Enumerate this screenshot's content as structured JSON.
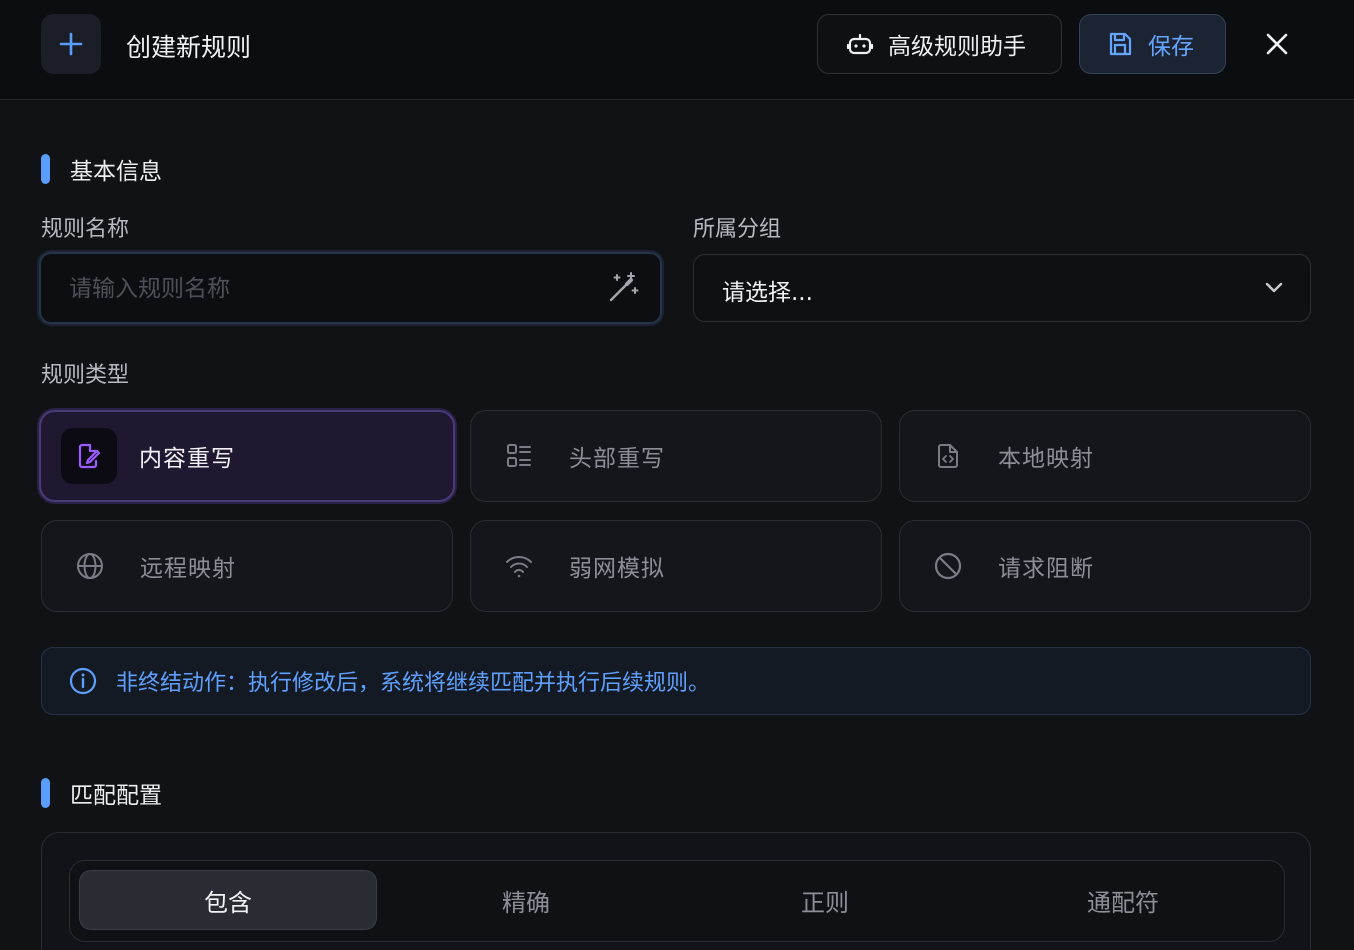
{
  "header": {
    "title": "创建新规则",
    "assistant_label": "高级规则助手",
    "save_label": "保存"
  },
  "basic": {
    "section_title": "基本信息",
    "name_label": "规则名称",
    "name_placeholder": "请输入规则名称",
    "name_value": "",
    "group_label": "所属分组",
    "group_value": "请选择...",
    "type_label": "规则类型",
    "types": [
      {
        "label": "内容重写",
        "icon": "edit-file-icon",
        "selected": true
      },
      {
        "label": "头部重写",
        "icon": "list-icon",
        "selected": false
      },
      {
        "label": "本地映射",
        "icon": "code-file-icon",
        "selected": false
      },
      {
        "label": "远程映射",
        "icon": "globe-icon",
        "selected": false
      },
      {
        "label": "弱网模拟",
        "icon": "wifi-icon",
        "selected": false
      },
      {
        "label": "请求阻断",
        "icon": "block-icon",
        "selected": false
      }
    ],
    "notice": "非终结动作：执行修改后，系统将继续匹配并执行后续规则。"
  },
  "match": {
    "section_title": "匹配配置",
    "modes": [
      "包含",
      "精确",
      "正则",
      "通配符"
    ],
    "selected_mode": "包含"
  },
  "colors": {
    "accent_blue": "#5b9dff",
    "accent_purple": "#9b5cff",
    "background": "#111216"
  }
}
